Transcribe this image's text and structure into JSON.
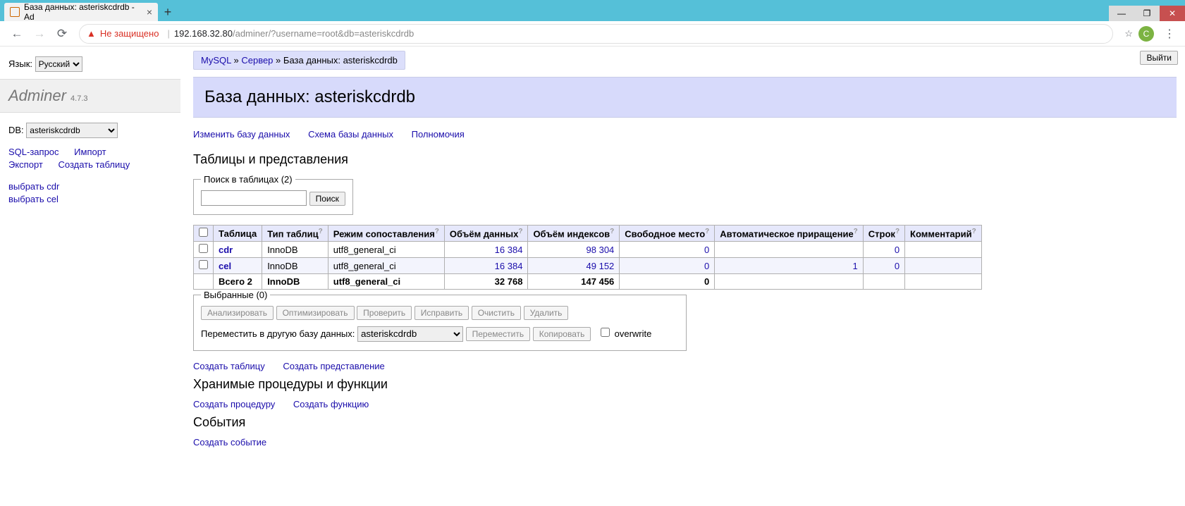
{
  "browser": {
    "tab_title": "База данных: asteriskcdrdb - Ad",
    "new_tab": "+",
    "nav": {
      "back": "←",
      "forward": "→",
      "reload": "⟳"
    },
    "insecure_label": "Не защищено",
    "url_host": "192.168.32.80",
    "url_path": "/adminer/?username=root&db=asteriskcdrdb",
    "avatar_letter": "С",
    "star": "☆",
    "kebab": "⋮",
    "win": {
      "min": "—",
      "max": "❐",
      "close": "✕"
    }
  },
  "sidebar": {
    "lang_label": "Язык:",
    "lang_value": "Русский",
    "title": "Adminer",
    "version": "4.7.3",
    "db_label": "DB:",
    "db_value": "asteriskcdrdb",
    "links": {
      "sql": "SQL-запрос",
      "import": "Импорт",
      "export": "Экспорт",
      "create_table": "Создать таблицу"
    },
    "tables": {
      "cdr": "выбрать cdr",
      "cel": "выбрать cel"
    }
  },
  "main": {
    "logout": "Выйти",
    "breadcrumb": {
      "mysql": "MySQL",
      "server": "Сервер",
      "sep": "»",
      "db_label": "База данных: asteriskcdrdb"
    },
    "h2": "База данных: asteriskcdrdb",
    "actions": {
      "alter": "Изменить базу данных",
      "schema": "Схема базы данных",
      "privileges": "Полномочия"
    },
    "h3_tables": "Таблицы и представления",
    "search": {
      "legend": "Поиск в таблицах (2)",
      "btn": "Поиск"
    },
    "table": {
      "headers": {
        "table": "Таблица",
        "engine": "Тип таблиц",
        "collation": "Режим сопоставления",
        "data_len": "Объём данных",
        "index_len": "Объём индексов",
        "data_free": "Свободное место",
        "auto_inc": "Автоматическое приращение",
        "rows": "Строк",
        "comment": "Комментарий",
        "help": "?"
      },
      "rows": [
        {
          "name": "cdr",
          "engine": "InnoDB",
          "collation": "utf8_general_ci",
          "data_len": "16 384",
          "index_len": "98 304",
          "data_free": "0",
          "auto_inc": "",
          "rows": "0",
          "comment": ""
        },
        {
          "name": "cel",
          "engine": "InnoDB",
          "collation": "utf8_general_ci",
          "data_len": "16 384",
          "index_len": "49 152",
          "data_free": "0",
          "auto_inc": "1",
          "rows": "0",
          "comment": ""
        }
      ],
      "footer": {
        "label": "Всего 2",
        "engine": "InnoDB",
        "collation": "utf8_general_ci",
        "data_len": "32 768",
        "index_len": "147 456",
        "data_free": "0",
        "auto_inc": "",
        "rows": "",
        "comment": ""
      }
    },
    "selected": {
      "legend": "Выбранные (0)",
      "analyze": "Анализировать",
      "optimize": "Оптимизировать",
      "check": "Проверить",
      "repair": "Исправить",
      "truncate": "Очистить",
      "drop": "Удалить",
      "move_label": "Переместить в другую базу данных:",
      "move_db": "asteriskcdrdb",
      "move_btn": "Переместить",
      "copy_btn": "Копировать",
      "overwrite": "overwrite"
    },
    "links2": {
      "create_table": "Создать таблицу",
      "create_view": "Создать представление"
    },
    "h3_routines": "Хранимые процедуры и функции",
    "links3": {
      "create_proc": "Создать процедуру",
      "create_func": "Создать функцию"
    },
    "h3_events": "События",
    "links4": {
      "create_event": "Создать событие"
    }
  }
}
